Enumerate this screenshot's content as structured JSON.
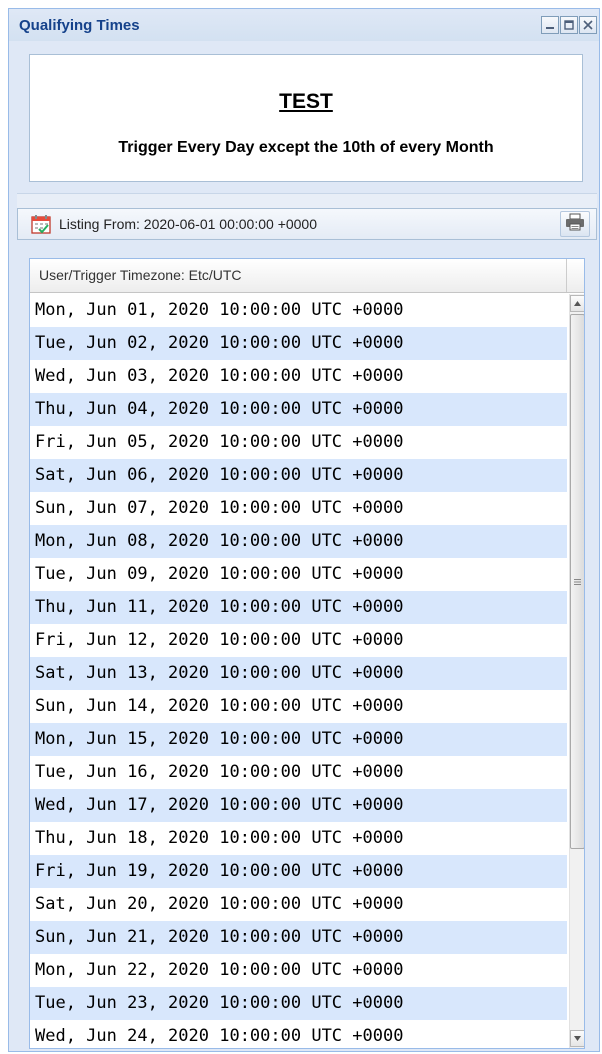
{
  "window": {
    "title": "Qualifying Times",
    "tools": [
      "minimize-icon",
      "maximize-icon",
      "close-icon"
    ]
  },
  "header": {
    "title": "TEST",
    "subtitle": "Trigger Every Day except the 10th of every Month"
  },
  "toolbar": {
    "listing_label": "Listing From: 2020-06-01 00:00:00 +0000",
    "calendar_icon": "calendar-icon",
    "print_icon": "print-icon"
  },
  "grid": {
    "column_header": "User/Trigger Timezone: Etc/UTC",
    "rows": [
      "Mon, Jun 01, 2020 10:00:00 UTC +0000",
      "Tue, Jun 02, 2020 10:00:00 UTC +0000",
      "Wed, Jun 03, 2020 10:00:00 UTC +0000",
      "Thu, Jun 04, 2020 10:00:00 UTC +0000",
      "Fri, Jun 05, 2020 10:00:00 UTC +0000",
      "Sat, Jun 06, 2020 10:00:00 UTC +0000",
      "Sun, Jun 07, 2020 10:00:00 UTC +0000",
      "Mon, Jun 08, 2020 10:00:00 UTC +0000",
      "Tue, Jun 09, 2020 10:00:00 UTC +0000",
      "Thu, Jun 11, 2020 10:00:00 UTC +0000",
      "Fri, Jun 12, 2020 10:00:00 UTC +0000",
      "Sat, Jun 13, 2020 10:00:00 UTC +0000",
      "Sun, Jun 14, 2020 10:00:00 UTC +0000",
      "Mon, Jun 15, 2020 10:00:00 UTC +0000",
      "Tue, Jun 16, 2020 10:00:00 UTC +0000",
      "Wed, Jun 17, 2020 10:00:00 UTC +0000",
      "Thu, Jun 18, 2020 10:00:00 UTC +0000",
      "Fri, Jun 19, 2020 10:00:00 UTC +0000",
      "Sat, Jun 20, 2020 10:00:00 UTC +0000",
      "Sun, Jun 21, 2020 10:00:00 UTC +0000",
      "Mon, Jun 22, 2020 10:00:00 UTC +0000",
      "Tue, Jun 23, 2020 10:00:00 UTC +0000",
      "Wed, Jun 24, 2020 10:00:00 UTC +0000"
    ]
  },
  "colors": {
    "window_bg": "#dfe8f6",
    "title_text": "#15428b",
    "row_alt": "#d8e7fc",
    "border": "#99bbe8"
  }
}
